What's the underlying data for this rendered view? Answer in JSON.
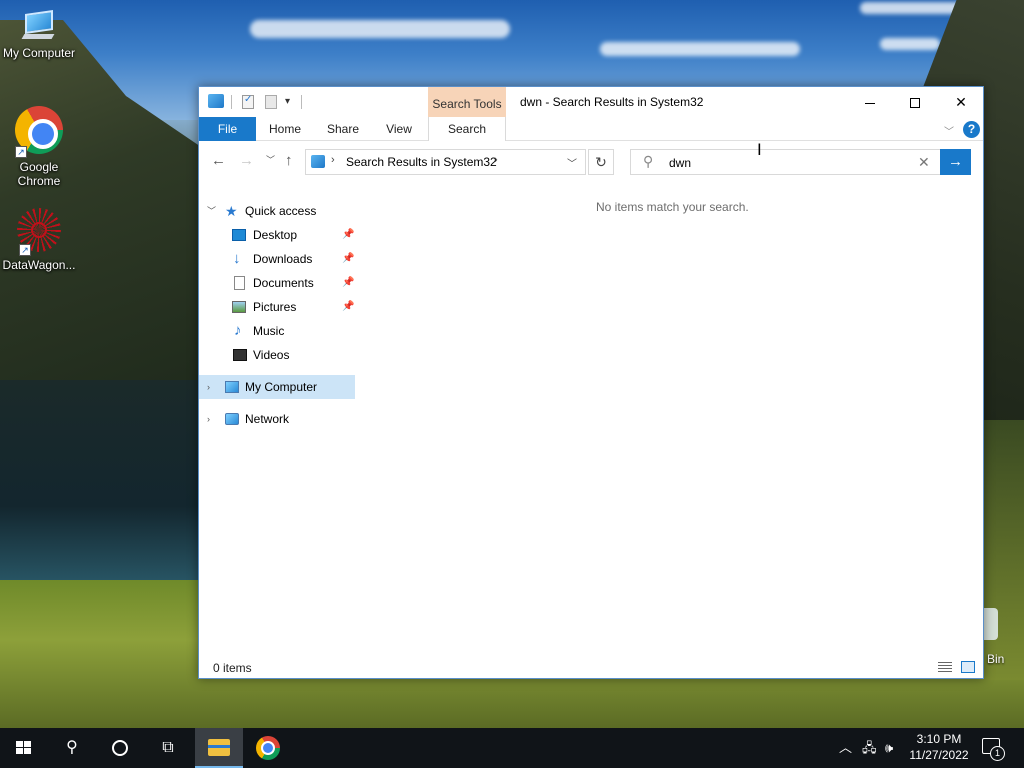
{
  "desktop": {
    "icons": [
      {
        "label": "My Computer",
        "icon": "computer-icon"
      },
      {
        "label": "Google Chrome",
        "icon": "chrome-icon"
      },
      {
        "label": "DataWagon...",
        "icon": "datawagon-icon"
      },
      {
        "label": "Bin",
        "icon": "recycle-bin-icon"
      }
    ]
  },
  "window": {
    "title": "dwn - Search Results in System32",
    "contextual_tab_group": "Search Tools",
    "ribbon_tabs": [
      "File",
      "Home",
      "Share",
      "View",
      "Search"
    ],
    "address": {
      "path": "Search Results in System32"
    },
    "search": {
      "value": "dwn"
    },
    "nav_pane": {
      "quick_access": "Quick access",
      "items": [
        {
          "label": "Desktop",
          "pinned": true
        },
        {
          "label": "Downloads",
          "pinned": true
        },
        {
          "label": "Documents",
          "pinned": true
        },
        {
          "label": "Pictures",
          "pinned": true
        },
        {
          "label": "Music",
          "pinned": false
        },
        {
          "label": "Videos",
          "pinned": false
        }
      ],
      "my_computer": "My Computer",
      "network": "Network"
    },
    "empty_message": "No items match your search.",
    "status": "0 items",
    "colors": {
      "accent": "#1979ca",
      "contextual_tab": "#f7d4b8",
      "selection": "#cce4f7"
    }
  },
  "taskbar": {
    "time": "3:10 PM",
    "date": "11/27/2022",
    "notification_count": "1"
  }
}
